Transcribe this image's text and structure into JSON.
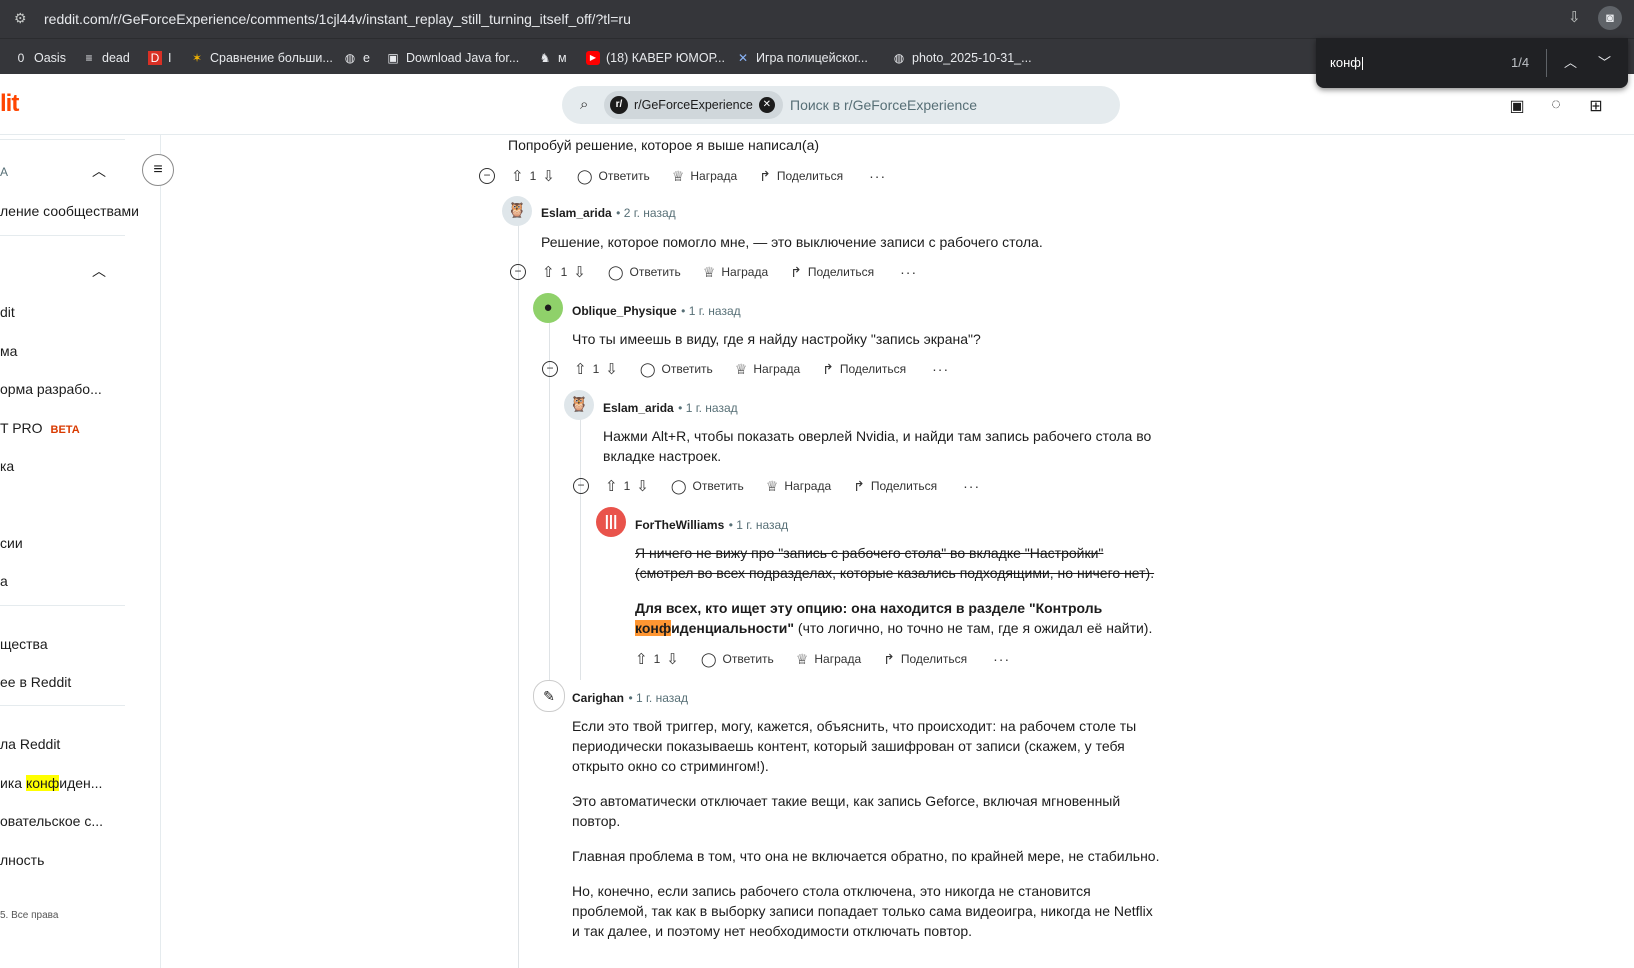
{
  "browser": {
    "url": "reddit.com/r/GeForceExperience/comments/1cjl44v/instant_replay_still_turning_itself_off/?tl=ru",
    "bookmarks": [
      {
        "icon": "0",
        "label": "Oasis"
      },
      {
        "icon": "≡",
        "label": "dead"
      },
      {
        "icon": "D",
        "label": "I"
      },
      {
        "icon": "✶",
        "label": "Сравнение больши..."
      },
      {
        "icon": "◍",
        "label": "e"
      },
      {
        "icon": "▣",
        "label": "Download Java for..."
      },
      {
        "icon": "♞",
        "label": "м"
      },
      {
        "icon": "▶",
        "label": "(18) КАВЕР ЮМОР..."
      },
      {
        "icon": "✕",
        "label": "Игра полицейског..."
      },
      {
        "icon": "◍",
        "label": "photo_2025-10-31_..."
      }
    ],
    "find": {
      "query": "конф",
      "count": "1/4"
    }
  },
  "header": {
    "logo": "lit",
    "search_chip": "r/GeForceExperience",
    "search_placeholder": "Поиск в r/GeForceExperience"
  },
  "sidebar": {
    "section1": "А",
    "items": [
      "ление сообществами",
      "dit",
      "ма",
      "орма разрабо...",
      "T PRO",
      "ка",
      "сии",
      "а",
      "щества",
      "ее в Reddit",
      "ла Reddit",
      "ика ",
      "овательское с...",
      "лность"
    ],
    "beta": "BETA",
    "privacy_hl": "конф",
    "privacy_rest": "иден...",
    "footer": "5. Все права"
  },
  "actions": {
    "reply": "Ответить",
    "award": "Награда",
    "share": "Поделиться"
  },
  "comments": [
    {
      "id": "c0",
      "text": "Попробуй решение, которое я выше написал(а)",
      "score": "1"
    },
    {
      "id": "c1",
      "author": "Eslam_arida",
      "time": "2 г. назад",
      "text": "Решение, которое помогло мне, — это выключение записи с рабочего стола.",
      "score": "1"
    },
    {
      "id": "c2",
      "author": "Oblique_Physique",
      "time": "1 г. назад",
      "text": "Что ты имеешь в виду, где я найду настройку \"запись экрана\"?",
      "score": "1"
    },
    {
      "id": "c3",
      "author": "Eslam_arida",
      "time": "1 г. назад",
      "text1": "Нажми Alt+R, чтобы показать оверлей Nvidia, и найди там запись рабочего стола во",
      "text2": "вкладке настроек.",
      "score": "1"
    },
    {
      "id": "c4",
      "author": "ForTheWilliams",
      "time": "1 г. назад",
      "strike1": "Я ничего не вижу про \"запись с рабочего стола\" во вкладке \"Настройки\"",
      "strike2": "(смотрел во всех подразделах, которые казались подходящими, но ничего нет).",
      "bold1": "Для всех, кто ищет эту опцию: она находится в разделе \"Контроль",
      "bold2_hl": "конф",
      "bold2_rest": "иденциальности\"",
      "normal2": " (что логично, но точно не там, где я ожидал её найти).",
      "score": "1"
    },
    {
      "id": "c5",
      "author": "Carighan",
      "time": "1 г. назад",
      "p1": [
        "Если это твой триггер, могу, кажется, объяснить, что происходит: на рабочем столе ты",
        "периодически показываешь контент, который зашифрован от записи (скажем, у тебя",
        "открыто окно со стримингом!)."
      ],
      "p2": [
        "Это автоматически отключает такие вещи, как запись Geforce, включая мгновенный",
        "повтор."
      ],
      "p3": [
        "Главная проблема в том, что она не включается обратно, по крайней мере, не стабильно."
      ],
      "p4": [
        "Но, конечно, если запись рабочего стола отключена, это никогда не становится",
        "проблемой, так как в выборку записи попадает только сама видеоигра, никогда не Netflix",
        "и так далее, и поэтому нет необходимости отключать повтор."
      ]
    }
  ]
}
